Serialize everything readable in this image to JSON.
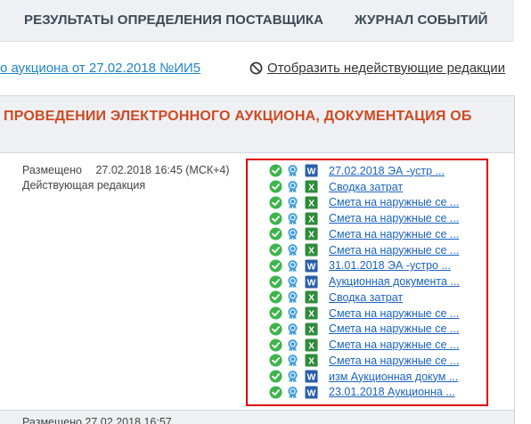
{
  "tabs": [
    {
      "label": "РЕЗУЛЬТАТЫ ОПРЕДЕЛЕНИЯ ПОСТАВЩИКА"
    },
    {
      "label": "ЖУРНАЛ СОБЫТИЙ"
    }
  ],
  "links": {
    "notice": "о аукциона от 27.02.2018 №ИИ5",
    "show_inactive": "Отобразить недействующие редакции"
  },
  "panel": {
    "title": "ПРОВЕДЕНИИ ЭЛЕКТРОННОГО АУКЦИОНА, ДОКУМЕНТАЦИЯ ОБ",
    "placed_label": "Размещено",
    "placed_value": "27.02.2018 16:45 (МСК+4)",
    "status": "Действующая редакция"
  },
  "documents": [
    {
      "type": "word",
      "name": "27.02.2018 ЭА -устр ..."
    },
    {
      "type": "excel",
      "name": "Сводка затрат"
    },
    {
      "type": "excel",
      "name": "Смета на наружные се ..."
    },
    {
      "type": "excel",
      "name": "Смета на наружные се ..."
    },
    {
      "type": "excel",
      "name": "Смета на наружные се ..."
    },
    {
      "type": "excel",
      "name": "Смета на наружные се ..."
    },
    {
      "type": "word",
      "name": "31.01.2018 ЭА -устро ..."
    },
    {
      "type": "word",
      "name": "Аукционная документа ..."
    },
    {
      "type": "excel",
      "name": "Сводка затрат"
    },
    {
      "type": "excel",
      "name": "Смета на наружные се ..."
    },
    {
      "type": "excel",
      "name": "Смета на наружные се ..."
    },
    {
      "type": "excel",
      "name": "Смета на наружные се ..."
    },
    {
      "type": "excel",
      "name": "Смета на наружные се ..."
    },
    {
      "type": "word",
      "name": "изм Аукционная докум ..."
    },
    {
      "type": "word",
      "name": "23.01.2018 Аукционна ..."
    }
  ],
  "bottom": {
    "partial": "Размещено 27.02.2018 16:57"
  },
  "colors": {
    "title_orange": "#cf4a22",
    "link_blue": "#1a63c2",
    "highlight_red": "#e00000",
    "check_green": "#3db54a",
    "excel_green": "#2e8b3a",
    "word_blue": "#2a5fa8",
    "seal_blue": "#3a9be0"
  },
  "icons": {
    "status": "check-circle-icon",
    "signature": "certificate-seal-icon",
    "excel": "excel-file-icon",
    "word": "word-file-icon",
    "ban": "ban-icon"
  }
}
